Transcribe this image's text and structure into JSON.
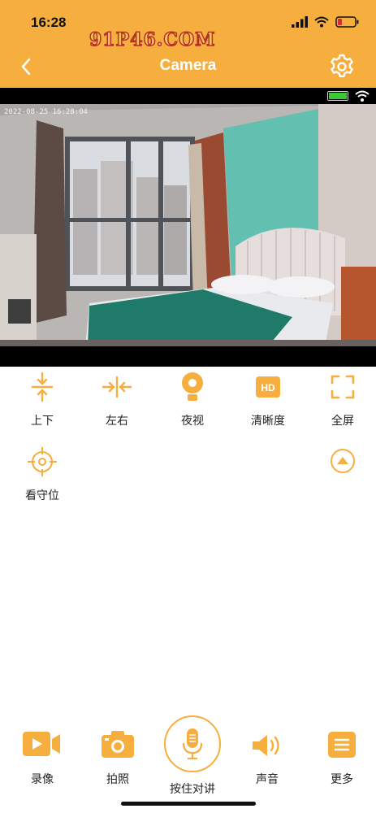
{
  "status_bar": {
    "time": "16:28"
  },
  "header": {
    "watermark": "91P46.COM",
    "title": "Camera"
  },
  "video": {
    "timestamp": "2022-08-25  16:28:04"
  },
  "controls": [
    {
      "label": "上下",
      "icon": "vertical-arrows-icon"
    },
    {
      "label": "左右",
      "icon": "horizontal-arrows-icon"
    },
    {
      "label": "夜视",
      "icon": "night-vision-icon"
    },
    {
      "label": "清晰度",
      "icon": "hd-icon"
    },
    {
      "label": "全屏",
      "icon": "fullscreen-icon"
    },
    {
      "label": "看守位",
      "icon": "crosshair-icon"
    }
  ],
  "bottom_bar": {
    "record": "录像",
    "snapshot": "拍照",
    "talk": "按住对讲",
    "sound": "声音",
    "more": "更多"
  },
  "colors": {
    "accent": "#F6AE3E",
    "header": "#F6AE3E"
  }
}
